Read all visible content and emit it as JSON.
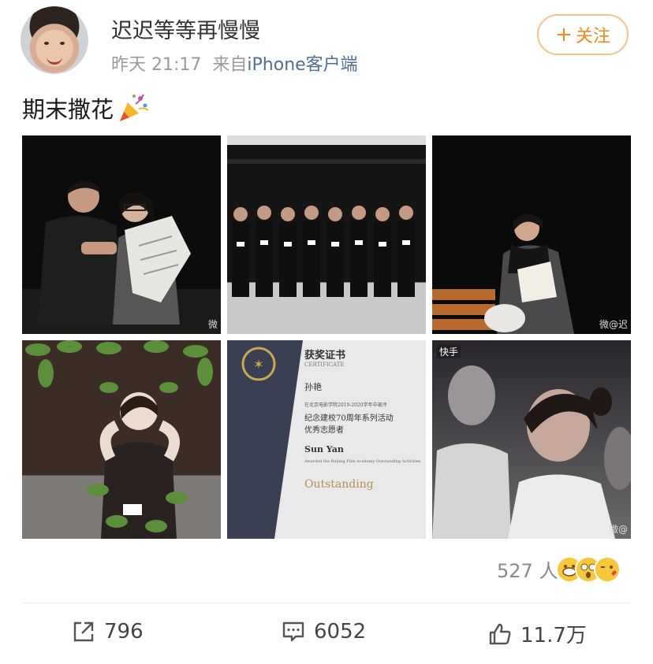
{
  "author": {
    "name": "迟迟等等再慢慢",
    "time": "昨天 21:17",
    "source_prefix": "来自",
    "source_client": "iPhone客户端"
  },
  "follow_button": {
    "plus": "+",
    "label": "关注"
  },
  "post": {
    "text": "期末撒花",
    "emoji_icon": "party-popper-icon",
    "images": [
      {
        "icon": "photo-rehearsal-two-actors",
        "watermark": "微"
      },
      {
        "icon": "photo-stage-lineup",
        "watermark": ""
      },
      {
        "icon": "photo-actress-bench",
        "watermark": "微@迟"
      },
      {
        "icon": "photo-leaf-costume",
        "watermark": ""
      },
      {
        "icon": "photo-certificate",
        "certificate": {
          "title": "获奖证书",
          "subtitle": "CERTIFICATE",
          "name_cn": "孙艳",
          "line1": "在北京电影学院2019-2020学年中被评",
          "line2": "纪念建校70周年系列活动",
          "line3": "优秀志愿者",
          "name_en": "Sun Yan",
          "line4": "Awarded the Beijing Film Academy Outstanding Activities",
          "outstanding": "Outstanding"
        },
        "watermark": ""
      },
      {
        "icon": "photo-girl-portrait",
        "logo_text": "快手",
        "watermark": "微@"
      }
    ]
  },
  "reactions": {
    "count_label": "527 人",
    "emoji_icons": [
      "grin-emoji-icon",
      "shock-emoji-icon",
      "kiss-emoji-icon"
    ]
  },
  "actions": {
    "repost": {
      "icon": "share-icon",
      "count": "796"
    },
    "comment": {
      "icon": "comment-icon",
      "count": "6052"
    },
    "like": {
      "icon": "thumbs-up-icon",
      "count": "11.7万"
    }
  },
  "colors": {
    "accent_orange": "#ef8a1c",
    "link_blue": "#4f6f97",
    "meta_gray": "#9b9b9b"
  }
}
